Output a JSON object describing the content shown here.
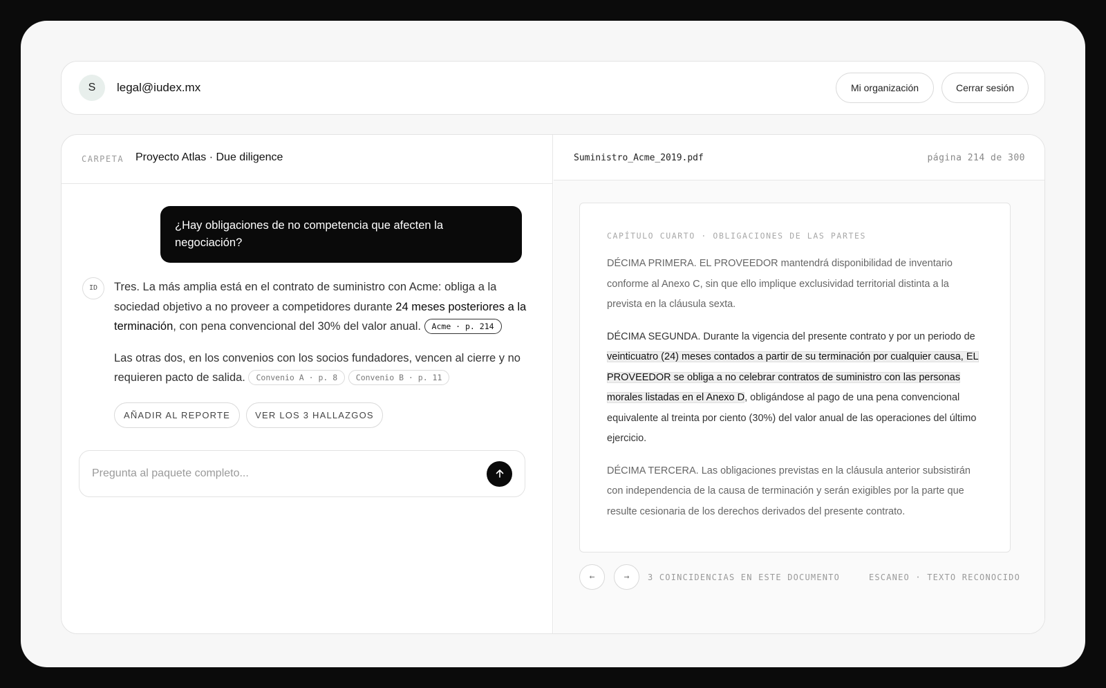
{
  "header": {
    "avatar_initial": "S",
    "email": "legal@iudex.mx",
    "org_button": "Mi organización",
    "logout_button": "Cerrar sesión"
  },
  "chat": {
    "folder_label": "CARPETA",
    "folder_name": "Proyecto Atlas · Due diligence",
    "question": "¿Hay obligaciones de no competencia que afecten la negociación?",
    "assistant_badge": "ID",
    "answer": {
      "p1_before": "Tres. La más amplia está en el contrato de suministro con Acme: obliga a la sociedad objetivo a no proveer a competidores durante ",
      "p1_highlight": "24 meses posteriores a la terminación",
      "p1_after": ", con pena convencional del 30% del valor anual. ",
      "p1_cite": "Acme · p. 214",
      "p2_text": "Las otras dos, en los convenios con los socios fundadores, vencen al cierre y no requieren pacto de salida. ",
      "p2_cite_a": "Convenio A · p. 8",
      "p2_cite_b": "Convenio B · p. 11"
    },
    "actions": {
      "add_report": "AÑADIR AL REPORTE",
      "view_findings": "VER LOS 3 HALLAZGOS"
    },
    "input": {
      "placeholder": "Pregunta al paquete completo...",
      "value": ""
    },
    "send_icon": "arrow-up-icon"
  },
  "viewer": {
    "filename": "Suministro_Acme_2019.pdf",
    "page_indicator": "página 214 de 300",
    "chapter": "CAPÍTULO CUARTO · OBLIGACIONES DE LAS PARTES",
    "clause1": "DÉCIMA PRIMERA. EL PROVEEDOR mantendrá disponibilidad de inventario conforme al Anexo C, sin que ello implique exclusividad territorial distinta a la prevista en la cláusula sexta.",
    "clause2_before": "DÉCIMA SEGUNDA. Durante la vigencia del presente contrato y por un periodo de ",
    "clause2_highlight": "veinticuatro (24) meses contados a partir de su terminación por cualquier causa, EL PROVEEDOR se obliga a no celebrar contratos de suministro con las personas morales listadas en el Anexo D",
    "clause2_after": ", obligándose al pago de una pena convencional equivalente al treinta por ciento (30%) del valor anual de las operaciones del último ejercicio.",
    "clause3": "DÉCIMA TERCERA. Las obligaciones previstas en la cláusula anterior subsistirán con independencia de la causa de terminación y serán exigibles por la parte que resulte cesionaria de los derechos derivados del presente contrato.",
    "prev_label": "←",
    "next_label": "→",
    "matches": "3 COINCIDENCIAS EN ESTE DOCUMENTO",
    "scan_status": "ESCANEO · TEXTO RECONOCIDO"
  },
  "colors": {
    "background": "#0b0b0b",
    "frame": "#f7f7f7",
    "accent_dark": "#0a0a0a",
    "highlight": "#efefef"
  }
}
